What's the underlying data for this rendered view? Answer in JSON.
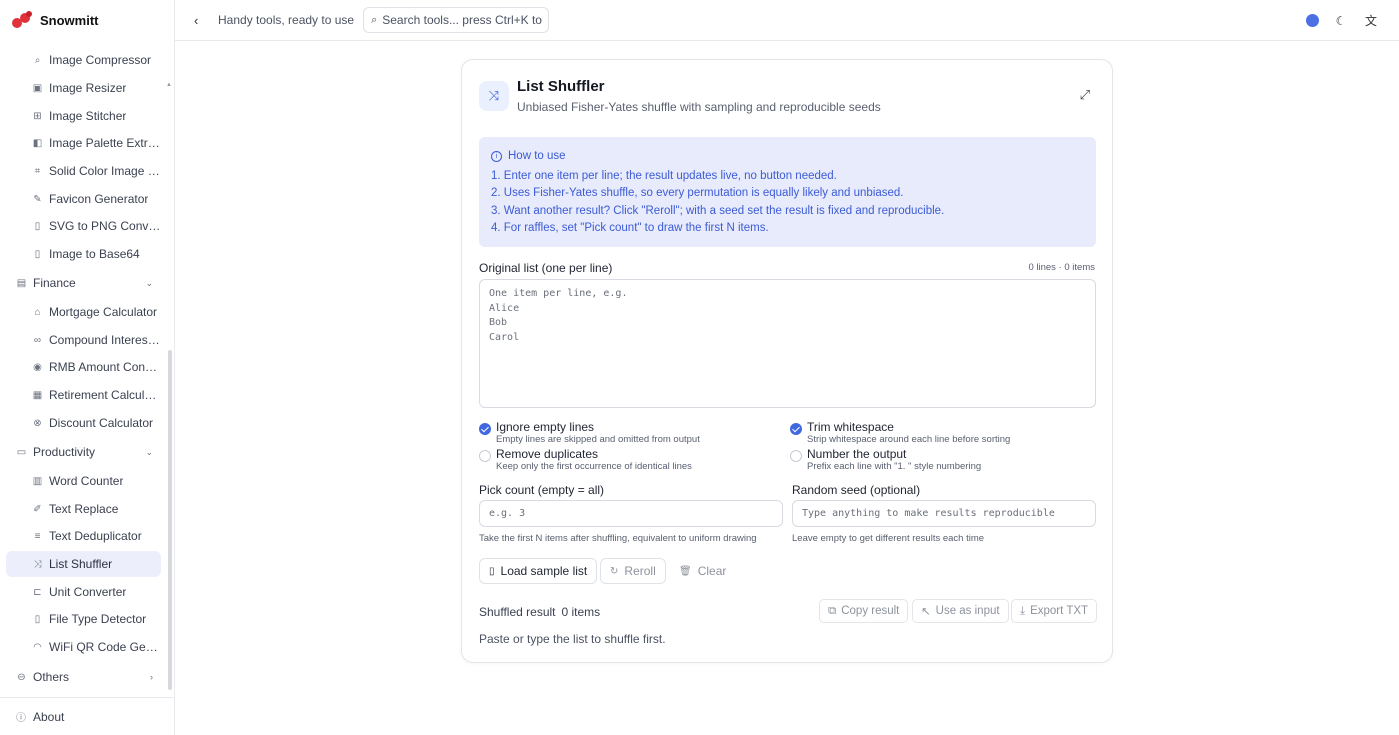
{
  "app": {
    "name": "Snowmitt",
    "tagline": "Handy tools, ready to use"
  },
  "search": {
    "placeholder": "Search tools... press Ctrl+K to focus"
  },
  "colors": {
    "accent": "#4068e0",
    "brand": "#e0323a",
    "info_bg": "#e7ebfb"
  },
  "sidebar": {
    "image_items": [
      {
        "label": "Image Compressor",
        "icon": "search-icon"
      },
      {
        "label": "Image Resizer",
        "icon": "image-icon"
      },
      {
        "label": "Image Stitcher",
        "icon": "grid-icon"
      },
      {
        "label": "Image Palette Extractor",
        "icon": "palette-icon"
      },
      {
        "label": "Solid Color Image Generator",
        "icon": "crop-icon"
      },
      {
        "label": "Favicon Generator",
        "icon": "brush-icon"
      },
      {
        "label": "SVG to PNG Converter",
        "icon": "file-icon"
      },
      {
        "label": "Image to Base64",
        "icon": "file-code-icon"
      }
    ],
    "finance": {
      "label": "Finance",
      "items": [
        {
          "label": "Mortgage Calculator",
          "icon": "home-icon"
        },
        {
          "label": "Compound Interest Calculator",
          "icon": "infinity-icon"
        },
        {
          "label": "RMB Amount Converter",
          "icon": "coin-icon"
        },
        {
          "label": "Retirement Calculator",
          "icon": "calendar-icon"
        },
        {
          "label": "Discount Calculator",
          "icon": "percent-icon"
        }
      ]
    },
    "productivity": {
      "label": "Productivity",
      "items": [
        {
          "label": "Word Counter",
          "icon": "chart-icon"
        },
        {
          "label": "Text Replace",
          "icon": "pen-icon"
        },
        {
          "label": "Text Deduplicator",
          "icon": "filter-icon"
        },
        {
          "label": "List Shuffler",
          "icon": "shuffle-icon"
        },
        {
          "label": "Unit Converter",
          "icon": "ruler-icon"
        },
        {
          "label": "File Type Detector",
          "icon": "file-search-icon"
        },
        {
          "label": "WiFi QR Code Generator",
          "icon": "wifi-icon"
        }
      ]
    },
    "others": {
      "label": "Others"
    },
    "about": {
      "label": "About"
    }
  },
  "tool": {
    "title": "List Shuffler",
    "subtitle": "Unbiased Fisher-Yates shuffle with sampling and reproducible seeds",
    "howto": {
      "heading": "How to use",
      "steps": [
        "1. Enter one item per line; the result updates live, no button needed.",
        "2. Uses Fisher-Yates shuffle, so every permutation is equally likely and unbiased.",
        "3. Want another result? Click \"Reroll\"; with a seed set the result is fixed and reproducible.",
        "4. For raffles, set \"Pick count\" to draw the first N items."
      ]
    },
    "original_label": "Original list (one per line)",
    "counter": "0 lines · 0 items",
    "textarea_placeholder": "One item per line, e.g.\nAlice\nBob\nCarol",
    "options": {
      "ignore_empty": {
        "title": "Ignore empty lines",
        "desc": "Empty lines are skipped and omitted from output",
        "checked": true
      },
      "trim": {
        "title": "Trim whitespace",
        "desc": "Strip whitespace around each line before sorting",
        "checked": true
      },
      "dedupe": {
        "title": "Remove duplicates",
        "desc": "Keep only the first occurrence of identical lines",
        "checked": false
      },
      "number": {
        "title": "Number the output",
        "desc": "Prefix each line with \"1. \" style numbering",
        "checked": false
      }
    },
    "pick": {
      "label": "Pick count (empty = all)",
      "placeholder": "e.g. 3",
      "hint": "Take the first N items after shuffling, equivalent to uniform drawing"
    },
    "seed": {
      "label": "Random seed (optional)",
      "placeholder": "Type anything to make results reproducible",
      "hint": "Leave empty to get different results each time"
    },
    "buttons": {
      "load_sample": "Load sample list",
      "reroll": "Reroll",
      "clear": "Clear"
    },
    "result": {
      "label": "Shuffled result",
      "count": "0 items",
      "copy": "Copy result",
      "use_as_input": "Use as input",
      "export": "Export TXT",
      "empty_message": "Paste or type the list to shuffle first."
    }
  }
}
